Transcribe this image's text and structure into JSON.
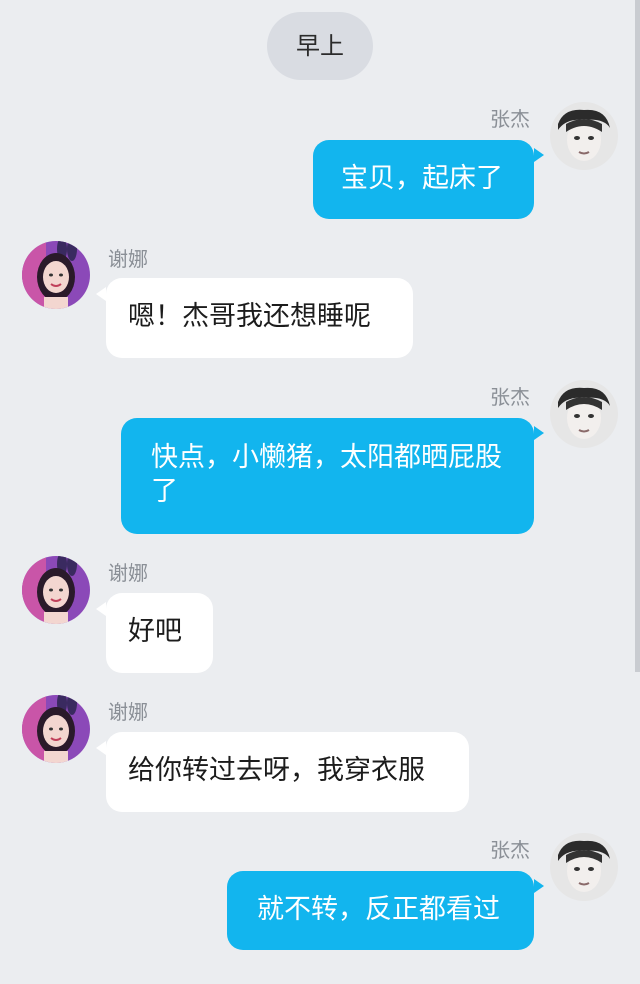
{
  "time_label": "早上",
  "messages": [
    {
      "sender": "张杰",
      "side": "right",
      "text": "宝贝，起床了"
    },
    {
      "sender": "谢娜",
      "side": "left",
      "text": "嗯！杰哥我还想睡呢"
    },
    {
      "sender": "张杰",
      "side": "right",
      "text": "快点，小懒猪，太阳都晒屁股了"
    },
    {
      "sender": "谢娜",
      "side": "left",
      "text": "好吧"
    },
    {
      "sender": "谢娜",
      "side": "left",
      "text": "给你转过去呀，我穿衣服"
    },
    {
      "sender": "张杰",
      "side": "right",
      "text": "就不转，反正都看过"
    }
  ],
  "colors": {
    "background": "#ebedf0",
    "outgoing_bubble": "#12b5ee",
    "incoming_bubble": "#ffffff",
    "name_text": "#8a8f96"
  }
}
